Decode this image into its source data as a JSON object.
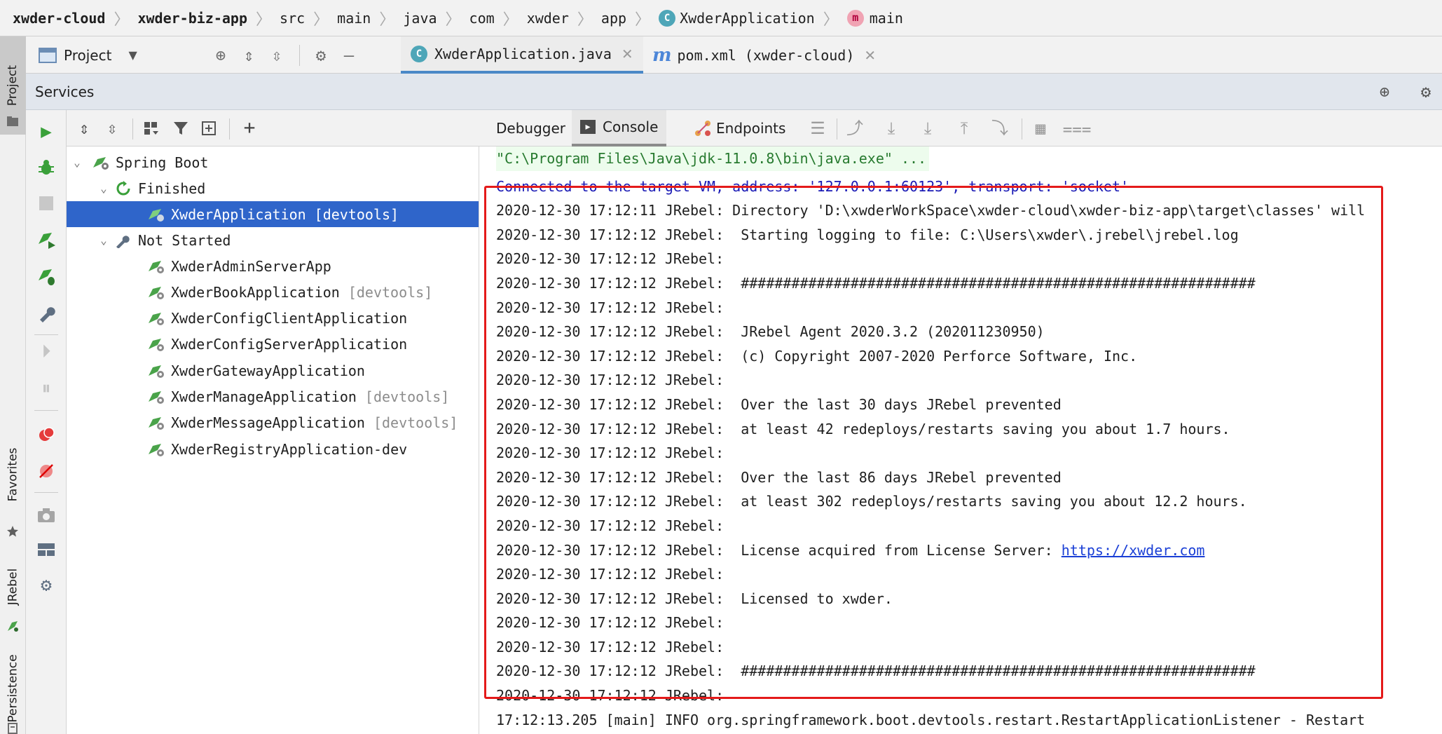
{
  "breadcrumb": {
    "items": [
      "xwder-cloud",
      "xwder-biz-app",
      "src",
      "main",
      "java",
      "com",
      "xwder",
      "app",
      "XwderApplication",
      "main"
    ]
  },
  "left_strip": {
    "tabs": {
      "project": "Project",
      "favorites": "Favorites",
      "jrebel": "JRebel",
      "persistence": "Persistence"
    }
  },
  "toolbar": {
    "project_selector": "Project",
    "editor_tabs": [
      {
        "label": "XwderApplication.java",
        "selected": true
      },
      {
        "label": "pom.xml (xwder-cloud)",
        "selected": false
      }
    ]
  },
  "services": {
    "title": "Services",
    "tree": {
      "root": "Spring Boot",
      "finished_group": "Finished",
      "not_started_group": "Not Started",
      "finished_items": [
        {
          "name": "XwderApplication",
          "tag": "[devtools]",
          "selected": true
        }
      ],
      "not_started_items": [
        {
          "name": "XwderAdminServerApp",
          "tag": ""
        },
        {
          "name": "XwderBookApplication",
          "tag": "[devtools]"
        },
        {
          "name": "XwderConfigClientApplication",
          "tag": ""
        },
        {
          "name": "XwderConfigServerApplication",
          "tag": ""
        },
        {
          "name": "XwderGatewayApplication",
          "tag": ""
        },
        {
          "name": "XwderManageApplication",
          "tag": "[devtools]"
        },
        {
          "name": "XwderMessageApplication",
          "tag": "[devtools]"
        },
        {
          "name": "XwderRegistryApplication-dev",
          "tag": ""
        }
      ]
    },
    "console_tabs": {
      "debugger": "Debugger",
      "console": "Console",
      "endpoints": "Endpoints"
    },
    "console_lines": [
      {
        "type": "cmd",
        "text": "\"C:\\Program Files\\Java\\jdk-11.0.8\\bin\\java.exe\" ..."
      },
      {
        "type": "conn",
        "text": "Connected to the target VM, address: '127.0.0.1:60123', transport: 'socket'"
      },
      {
        "type": "log",
        "text": "2020-12-30 17:12:11 JRebel: Directory 'D:\\xwderWorkSpace\\xwder-cloud\\xwder-biz-app\\target\\classes' will"
      },
      {
        "type": "log",
        "text": "2020-12-30 17:12:12 JRebel:  Starting logging to file: C:\\Users\\xwder\\.jrebel\\jrebel.log"
      },
      {
        "type": "log",
        "text": "2020-12-30 17:12:12 JRebel:"
      },
      {
        "type": "log",
        "text": "2020-12-30 17:12:12 JRebel:  #############################################################"
      },
      {
        "type": "log",
        "text": "2020-12-30 17:12:12 JRebel:"
      },
      {
        "type": "log",
        "text": "2020-12-30 17:12:12 JRebel:  JRebel Agent 2020.3.2 (202011230950)"
      },
      {
        "type": "log",
        "text": "2020-12-30 17:12:12 JRebel:  (c) Copyright 2007-2020 Perforce Software, Inc."
      },
      {
        "type": "log",
        "text": "2020-12-30 17:12:12 JRebel:"
      },
      {
        "type": "log",
        "text": "2020-12-30 17:12:12 JRebel:  Over the last 30 days JRebel prevented"
      },
      {
        "type": "log",
        "text": "2020-12-30 17:12:12 JRebel:  at least 42 redeploys/restarts saving you about 1.7 hours."
      },
      {
        "type": "log",
        "text": "2020-12-30 17:12:12 JRebel:"
      },
      {
        "type": "log",
        "text": "2020-12-30 17:12:12 JRebel:  Over the last 86 days JRebel prevented"
      },
      {
        "type": "log",
        "text": "2020-12-30 17:12:12 JRebel:  at least 302 redeploys/restarts saving you about 12.2 hours."
      },
      {
        "type": "log",
        "text": "2020-12-30 17:12:12 JRebel:"
      },
      {
        "type": "link",
        "text": "2020-12-30 17:12:12 JRebel:  License acquired from License Server: ",
        "link": "https://xwder.com"
      },
      {
        "type": "log",
        "text": "2020-12-30 17:12:12 JRebel:"
      },
      {
        "type": "log",
        "text": "2020-12-30 17:12:12 JRebel:  Licensed to xwder."
      },
      {
        "type": "log",
        "text": "2020-12-30 17:12:12 JRebel:"
      },
      {
        "type": "log",
        "text": "2020-12-30 17:12:12 JRebel:"
      },
      {
        "type": "log",
        "text": "2020-12-30 17:12:12 JRebel:  #############################################################"
      },
      {
        "type": "log",
        "text": "2020-12-30 17:12:12 JRebel:"
      },
      {
        "type": "log",
        "text": "17:12:13.205 [main] INFO org.springframework.boot.devtools.restart.RestartApplicationListener - Restart"
      }
    ]
  },
  "colors": {
    "accent": "#2f65ca",
    "highlight_box": "#e41a1a",
    "run_green": "#3aa03a"
  }
}
